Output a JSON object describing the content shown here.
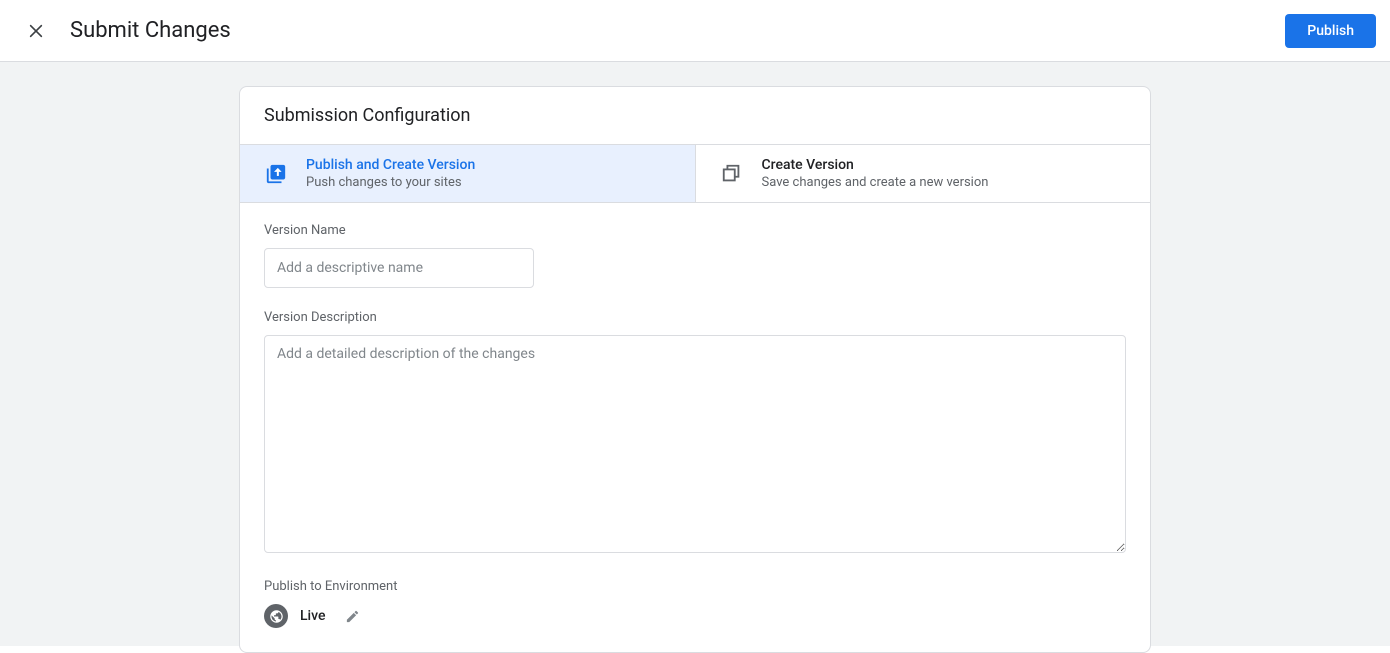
{
  "header": {
    "title": "Submit Changes",
    "publish_button": "Publish"
  },
  "card": {
    "title": "Submission Configuration"
  },
  "tabs": {
    "publish": {
      "title": "Publish and Create Version",
      "subtitle": "Push changes to your sites"
    },
    "create": {
      "title": "Create Version",
      "subtitle": "Save changes and create a new version"
    }
  },
  "form": {
    "version_name_label": "Version Name",
    "version_name_placeholder": "Add a descriptive name",
    "version_name_value": "",
    "version_description_label": "Version Description",
    "version_description_placeholder": "Add a detailed description of the changes",
    "version_description_value": "",
    "publish_env_label": "Publish to Environment",
    "env_name": "Live"
  }
}
